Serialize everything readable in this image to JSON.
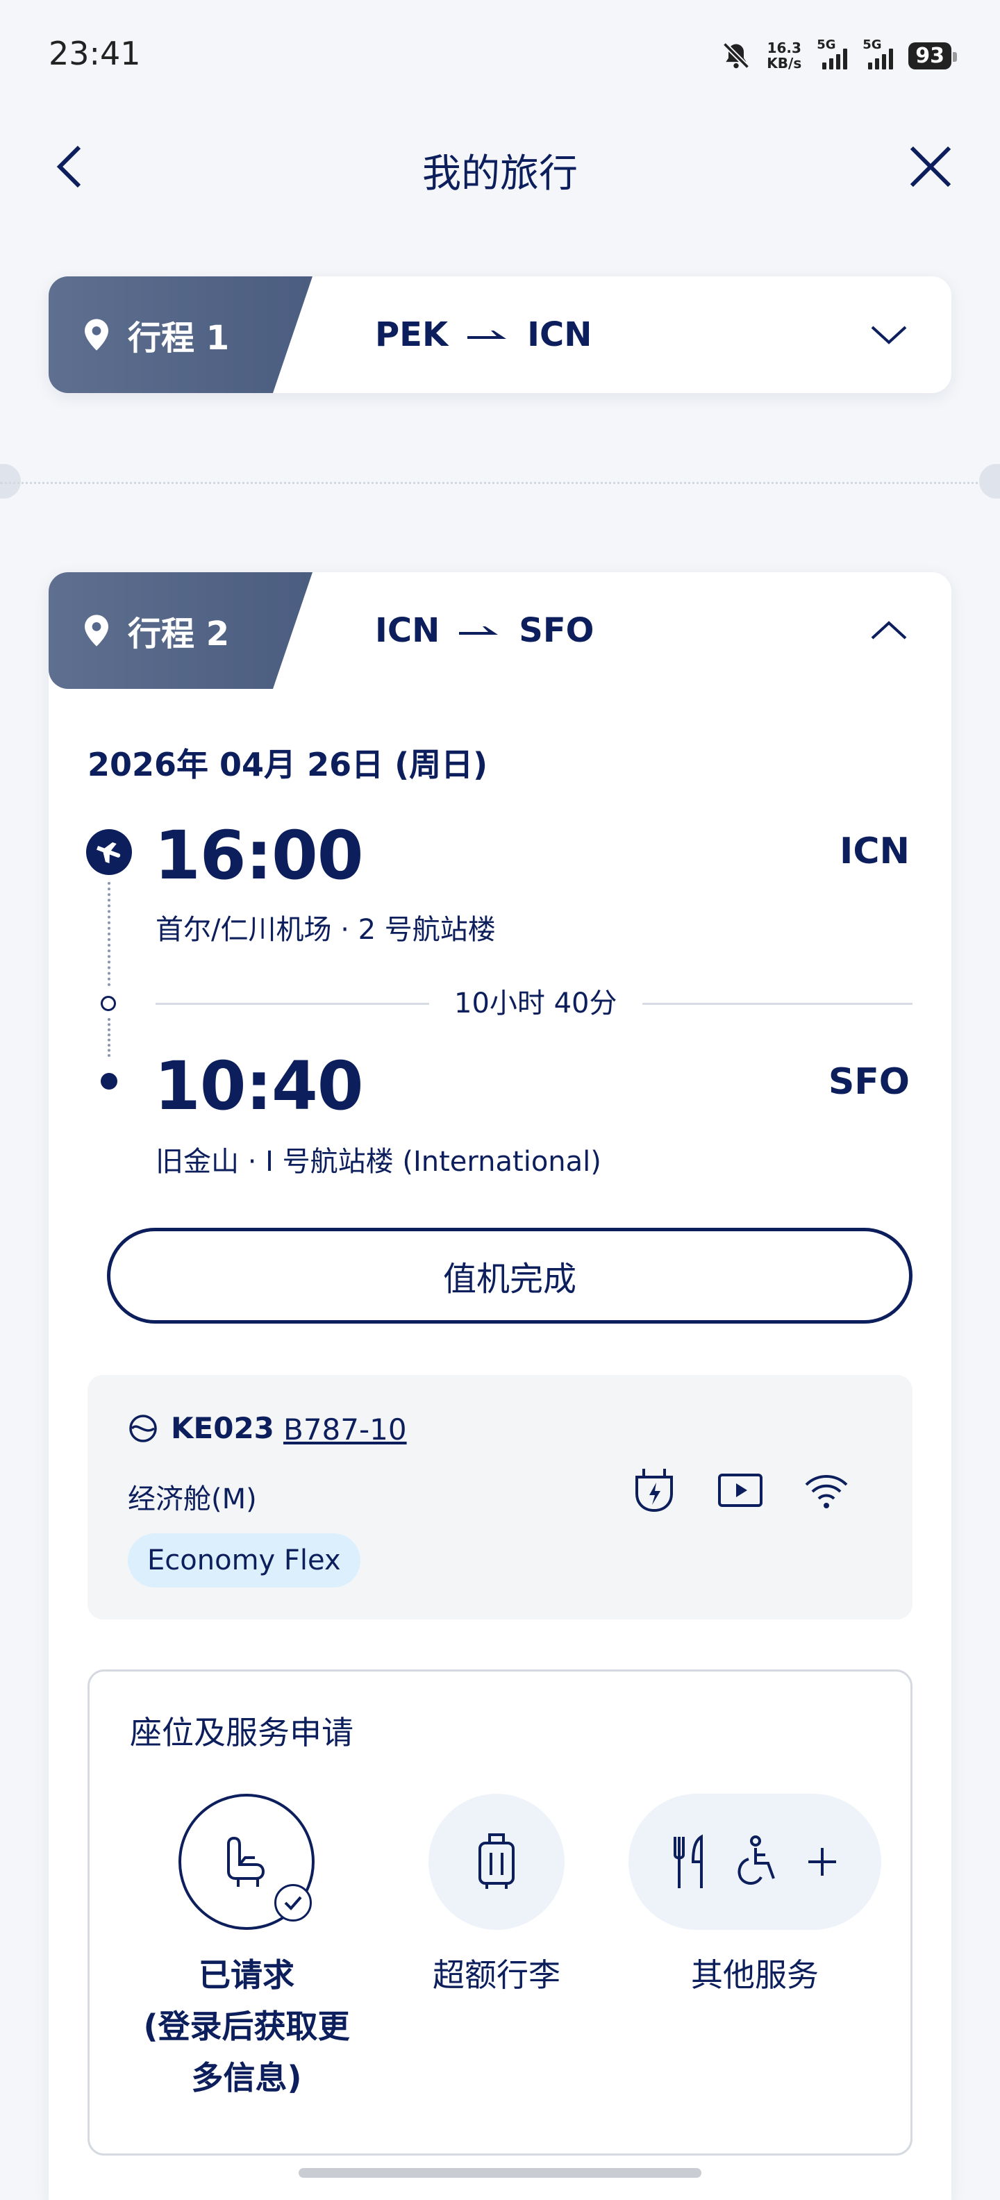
{
  "status_bar": {
    "time": "23:41",
    "net_speed_value": "16.3",
    "net_speed_unit": "KB/s",
    "signal_label_1": "5G",
    "signal_label_2": "5G",
    "battery": "93",
    "icons": [
      "bell-muted-icon",
      "signal-icon",
      "battery-icon"
    ]
  },
  "header": {
    "title": "我的旅行",
    "back_icon": "chevron-left-icon",
    "close_icon": "close-icon"
  },
  "itinerary_1": {
    "label": "行程 1",
    "origin": "PEK",
    "destination": "ICN",
    "expanded": false
  },
  "itinerary_2": {
    "label": "行程 2",
    "origin": "ICN",
    "destination": "SFO",
    "expanded": true,
    "date": "2026年 04月 26日 (周日)",
    "departure": {
      "time": "16:00",
      "code": "ICN",
      "airport": "首尔/仁川机场 · 2 号航站楼"
    },
    "duration": "10小时 40分",
    "arrival": {
      "time": "10:40",
      "code": "SFO",
      "airport": "旧金山 · I 号航站楼 (International)"
    },
    "checkin_button": "值机完成",
    "flight": {
      "number": "KE023",
      "aircraft": "B787-10",
      "cabin": "经济舱(M)",
      "fare": "Economy Flex",
      "amenities": [
        "power-outlet-icon",
        "video-icon",
        "wifi-icon"
      ]
    },
    "services": {
      "title": "座位及服务申请",
      "items": [
        {
          "label_line1": "已请求",
          "label_line2": "(登录后获取更",
          "label_line3": "多信息)",
          "icon": "seat-icon"
        },
        {
          "label": "超额行李",
          "icon": "luggage-icon"
        },
        {
          "label": "其他服务",
          "icon": "meal-wheelchair-plus-icon"
        }
      ]
    }
  },
  "colors": {
    "primary": "#0c1f5c",
    "tab_bg": "#54668a",
    "fare_badge": "#dceffd"
  }
}
